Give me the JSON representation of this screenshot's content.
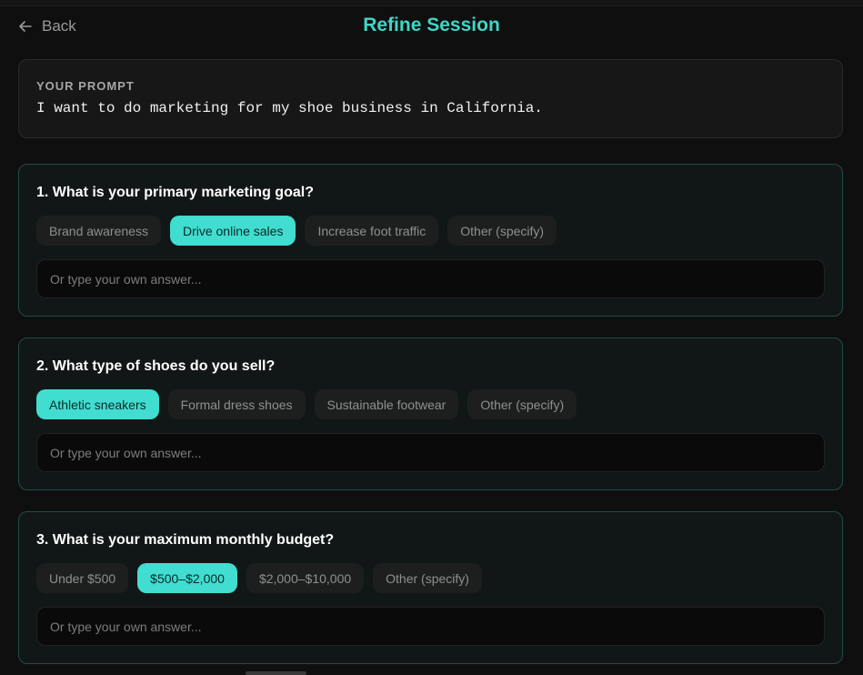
{
  "header": {
    "back_label": "Back",
    "title": "Refine Session"
  },
  "prompt": {
    "label": "YOUR PROMPT",
    "text": "I want to do marketing for my shoe business in California."
  },
  "questions": [
    {
      "title": "1. What is your primary marketing goal?",
      "options": [
        {
          "label": "Brand awareness",
          "selected": false
        },
        {
          "label": "Drive online sales",
          "selected": true
        },
        {
          "label": "Increase foot traffic",
          "selected": false
        },
        {
          "label": "Other (specify)",
          "selected": false
        }
      ],
      "placeholder": "Or type your own answer..."
    },
    {
      "title": "2. What type of shoes do you sell?",
      "options": [
        {
          "label": "Athletic sneakers",
          "selected": true
        },
        {
          "label": "Formal dress shoes",
          "selected": false
        },
        {
          "label": "Sustainable footwear",
          "selected": false
        },
        {
          "label": "Other (specify)",
          "selected": false
        }
      ],
      "placeholder": "Or type your own answer..."
    },
    {
      "title": "3. What is your maximum monthly budget?",
      "options": [
        {
          "label": "Under $500",
          "selected": false
        },
        {
          "label": "$500–$2,000",
          "selected": true
        },
        {
          "label": "$2,000–$10,000",
          "selected": false
        },
        {
          "label": "Other (specify)",
          "selected": false
        }
      ],
      "placeholder": "Or type your own answer..."
    }
  ],
  "colors": {
    "accent": "#40ddd0",
    "title": "#3fd6c6",
    "card_border": "#1f4d47"
  }
}
